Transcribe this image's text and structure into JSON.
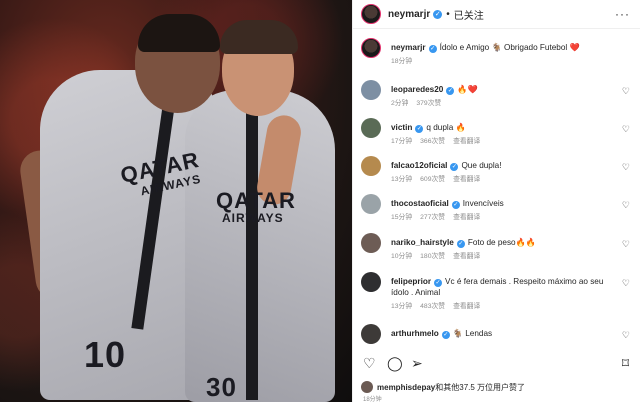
{
  "post": {
    "username": "neymarjr",
    "verified_mark": "✓",
    "dot": "•",
    "follow_status": "已关注",
    "more": "···",
    "time_footer": "18分钟"
  },
  "photo": {
    "jersey_sponsor": "QATAR",
    "jersey_sponsor_sub": "AIRWAYS",
    "number_left": "10",
    "number_right": "30"
  },
  "caption": {
    "user": "neymarjr",
    "text": "Ídolo e Amigo 🐐 Obrigado Futebol ❤️",
    "time": "18分钟"
  },
  "comments": [
    {
      "user": "leoparedes20",
      "verified": true,
      "text": "🔥❤️",
      "time": "2分钟",
      "likes": "379次赞",
      "translate": ""
    },
    {
      "user": "victin",
      "verified": true,
      "text": "q dupla 🔥",
      "time": "17分钟",
      "likes": "366次赞",
      "translate": "查看翻译"
    },
    {
      "user": "falcao12oficial",
      "verified": true,
      "text": "Que dupla!",
      "time": "13分钟",
      "likes": "609次赞",
      "translate": "查看翻译"
    },
    {
      "user": "thocostaoficial",
      "verified": true,
      "text": "Invencíveis",
      "time": "15分钟",
      "likes": "277次赞",
      "translate": "查看翻译"
    },
    {
      "user": "nariko_hairstyle",
      "verified": true,
      "text": "Foto de peso🔥🔥",
      "time": "10分钟",
      "likes": "180次赞",
      "translate": "查看翻译"
    },
    {
      "user": "felipeprior",
      "verified": true,
      "text": "Vc é fera demais . Respeito máximo ao seu ídolo . Animal",
      "time": "13分钟",
      "likes": "483次赞",
      "translate": "查看翻译"
    },
    {
      "user": "arthurhmelo",
      "verified": true,
      "text": "🐐 Lendas",
      "time": "",
      "likes": "",
      "translate": ""
    }
  ],
  "actions": {
    "like_icon": "heart-outline",
    "comment_icon": "comment",
    "share_icon": "send",
    "save_icon": "bookmark"
  },
  "likes_line": {
    "user": "memphisdepay",
    "text": "和其他37.5 万位用户赞了"
  },
  "colors": {
    "verified": "#3897f0",
    "muted": "#8e8e8e",
    "text": "#262626"
  }
}
